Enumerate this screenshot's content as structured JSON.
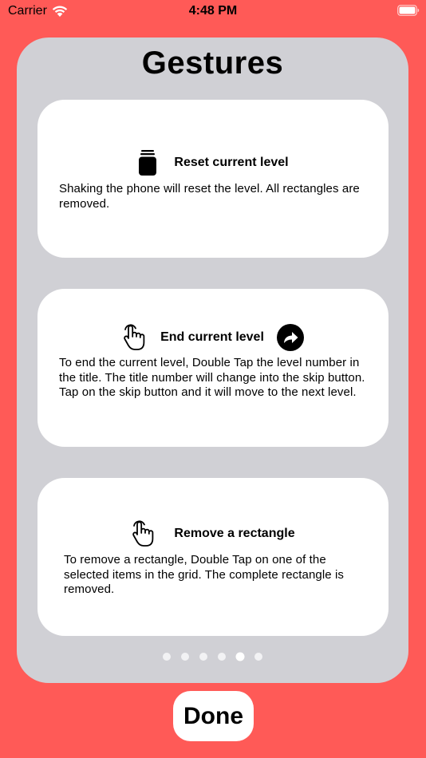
{
  "status_bar": {
    "carrier": "Carrier",
    "time": "4:48 PM",
    "wifi_icon": "wifi-icon",
    "battery_icon": "battery-icon"
  },
  "panel": {
    "title": "Gestures",
    "cards": [
      {
        "icon": "phone-shake-icon",
        "title": "Reset current level",
        "body": "Shaking the phone will reset the level.  All rectangles are removed."
      },
      {
        "icon": "hand-tap-icon",
        "title": "End current level",
        "trailing_icon": "skip-forward-icon",
        "body": "To end the current level, Double Tap the level number in the title.  The title number will change into the skip button. Tap on the skip button and it will move to the next level."
      },
      {
        "icon": "hand-tap-icon",
        "title": "Remove a rectangle",
        "body": "To remove a rectangle, Double Tap on one of the selected items in the grid.  The complete rectangle is removed."
      }
    ],
    "page_indicator": {
      "count": 6,
      "current": 5
    }
  },
  "done_button": {
    "label": "Done"
  },
  "colors": {
    "background": "#ff5a57",
    "panel": "#d0d0d5",
    "card": "#ffffff"
  }
}
